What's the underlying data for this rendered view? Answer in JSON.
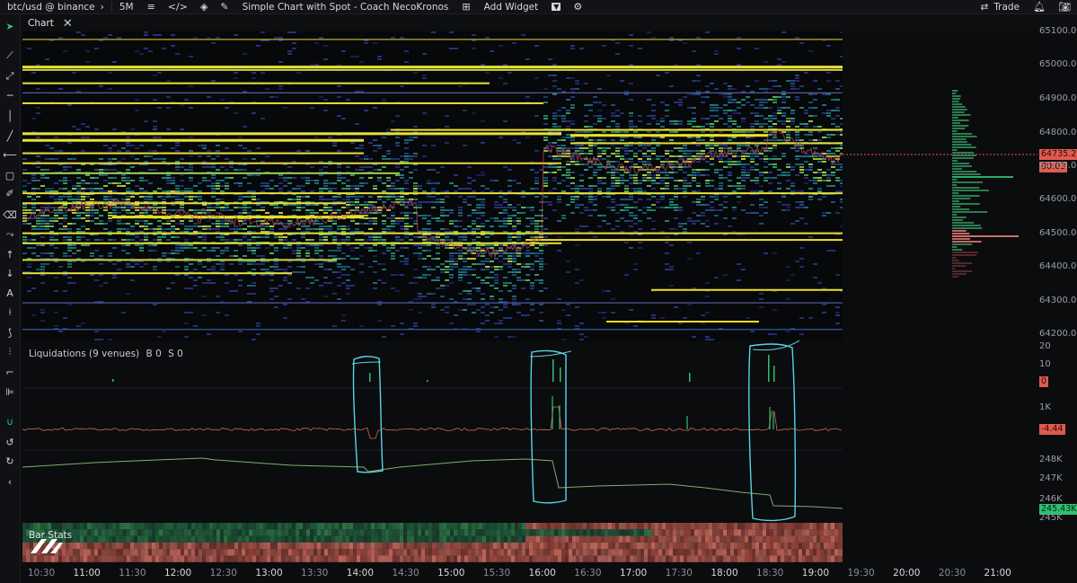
{
  "topbar": {
    "symbol": "btc/usd @ binance",
    "timeframe": "5M",
    "layout_name": "Simple Chart with Spot - Coach NecoKronos",
    "add_widget": "Add Widget",
    "trade": "Trade",
    "icons": [
      "chevron-right-icon",
      "candles-icon",
      "code-icon",
      "layers-icon",
      "pencil-icon",
      "grid-icon",
      "dropdown-icon",
      "gear-icon",
      "swap-icon",
      "bell-icon",
      "camera-icon"
    ]
  },
  "tab": {
    "label": "Chart",
    "close": "✕"
  },
  "sidebar": {
    "tools": [
      "cursor-icon",
      "trendline-icon",
      "ray-icon",
      "horizontal-line-icon",
      "vertical-line-icon",
      "line-icon",
      "extended-line-icon",
      "rectangle-icon",
      "brush-icon",
      "eraser-icon",
      "path-icon",
      "arrow-up-icon",
      "arrow-down-icon",
      "text-icon",
      "ruler-icon",
      "fib-icon",
      "candle-tool-icon",
      "measure-icon",
      "stats-icon",
      "magnet-icon",
      "undo-icon",
      "redo-icon",
      "collapse-icon"
    ]
  },
  "price_axis": {
    "labels": [
      "65100.0",
      "65000.0",
      "64900.0",
      "64800.0",
      "64700.0",
      "64600.0",
      "64500.0",
      "64400.0",
      "64300.0",
      "64200.0"
    ],
    "last_price": "64735.2",
    "countdown": "00:03"
  },
  "liquidations": {
    "title": "Liquidations (9 venues)",
    "b_label": "B",
    "b_value": "0",
    "s_label": "S",
    "s_value": "0",
    "axis_labels": [
      "20",
      "10"
    ],
    "badge": "0"
  },
  "cvd_panel": {
    "axis_label": "1K",
    "badge": "-4.44"
  },
  "oi_panel": {
    "axis_labels": [
      "248K",
      "247K",
      "246K",
      "245K"
    ],
    "badge": "245.43K"
  },
  "bar_stats": {
    "label": "Bar Stats"
  },
  "time_axis": {
    "labels": [
      "10:30",
      "11:00",
      "11:30",
      "12:00",
      "12:30",
      "13:00",
      "13:30",
      "14:00",
      "14:30",
      "15:00",
      "15:30",
      "16:00",
      "16:30",
      "17:00",
      "17:30",
      "18:00",
      "18:30",
      "19:00",
      "19:30",
      "20:00",
      "20:30",
      "21:00"
    ]
  },
  "colors": {
    "accent_red": "#e05a4f",
    "accent_green": "#2fbf71",
    "annotation": "#59d3e6",
    "heat_yellow": "#f0e020"
  }
}
